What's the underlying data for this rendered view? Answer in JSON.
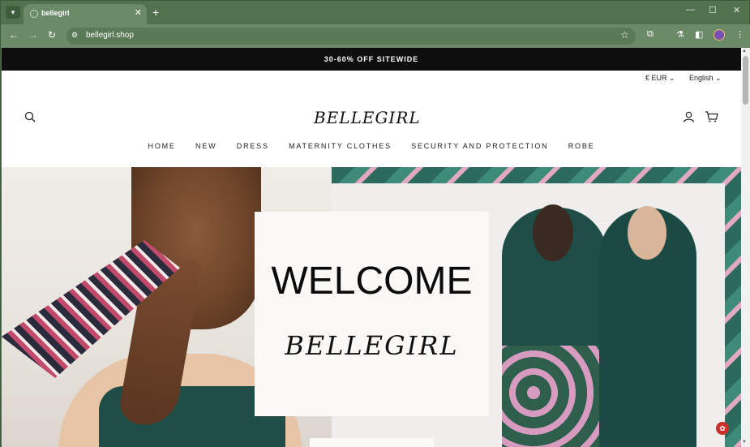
{
  "browser": {
    "tab_title": "bellegirl",
    "tab_close": "✕",
    "new_tab": "+",
    "url": "bellegirl.shop",
    "controls": {
      "minimize": "—",
      "maximize": "☐",
      "close": "✕"
    }
  },
  "site": {
    "announcement": "30-60% OFF SITEWIDE",
    "currency": "€ EUR ⌄",
    "language": "English ⌄",
    "logo": "BELLEGIRL",
    "nav": [
      "HOME",
      "NEW",
      "DRESS",
      "MATERNITY CLOTHES",
      "SECURITY AND PROTECTION",
      "ROBE"
    ],
    "hero": {
      "title": "WELCOME",
      "brand": "BELLEGIRL"
    }
  },
  "icons": {
    "search": "search-icon",
    "account": "account-icon",
    "cart": "cart-icon"
  },
  "colors": {
    "browser_frame": "#52714f",
    "announcement_bar": "#0e0e0e",
    "badge": "#c8302c"
  }
}
